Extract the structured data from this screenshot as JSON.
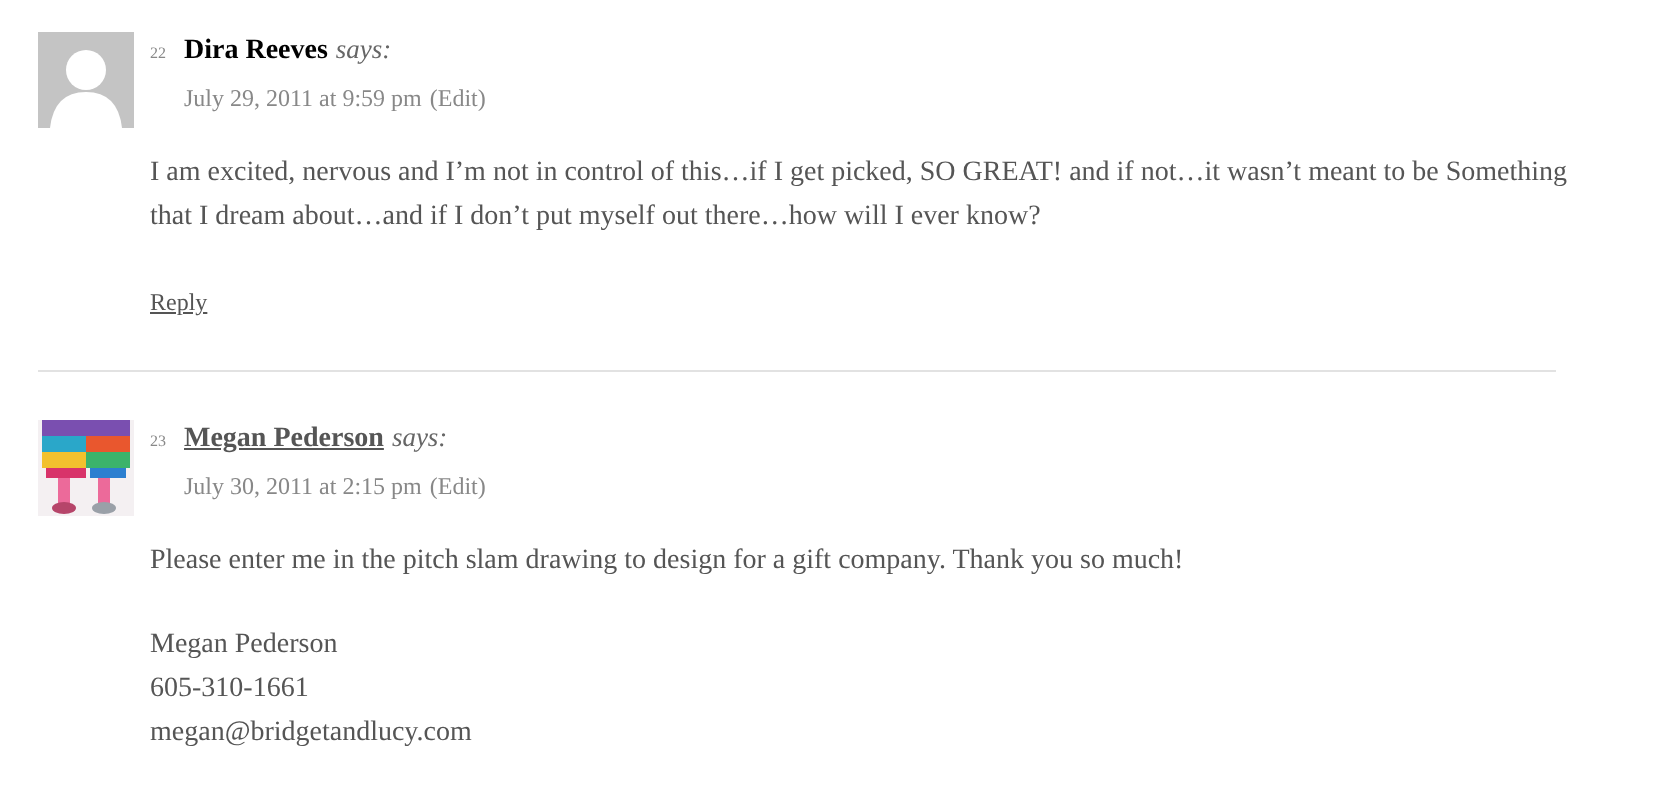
{
  "comments": [
    {
      "number": "22",
      "author": "Dira Reeves",
      "author_linked": false,
      "says": "says:",
      "date": "July 29, 2011 at 9:59 pm",
      "edit": "(Edit)",
      "avatar": {
        "kind": "default"
      },
      "paragraphs": [
        [
          "I am excited, nervous and I’m not in control of this…if I get picked, SO GREAT! and if not…it wasn’t meant to be Something that I dream about…and if I don’t put myself out there…how will I ever know?"
        ]
      ],
      "reply": "Reply"
    },
    {
      "number": "23",
      "author": "Megan Pederson",
      "author_linked": true,
      "says": "says:",
      "date": "July 30, 2011 at 2:15 pm",
      "edit": "(Edit)",
      "avatar": {
        "kind": "picture"
      },
      "paragraphs": [
        [
          "Please enter me in the pitch slam drawing to design for a gift company. Thank you so much!"
        ],
        [
          "Megan Pederson",
          "605-310-1661",
          "megan@bridgetandlucy.com"
        ]
      ]
    }
  ]
}
